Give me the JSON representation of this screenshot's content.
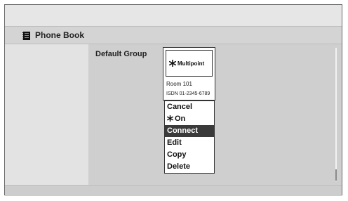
{
  "header": {
    "title": "Phone Book"
  },
  "main": {
    "group_label": "Default Group"
  },
  "card": {
    "name": "Multipoint",
    "room": "Room 101",
    "isdn": "ISDN 01-2345-6789",
    "icon": "snowflake-icon"
  },
  "menu": {
    "items": [
      {
        "label": "Cancel"
      },
      {
        "label": "On",
        "icon": "snowflake-icon"
      },
      {
        "label": "Connect",
        "selected": true
      },
      {
        "label": "Edit"
      },
      {
        "label": "Copy"
      },
      {
        "label": "Delete"
      }
    ]
  },
  "colors": {
    "selected_bg": "#3a3a3a",
    "panel": "#cfcfcf"
  }
}
